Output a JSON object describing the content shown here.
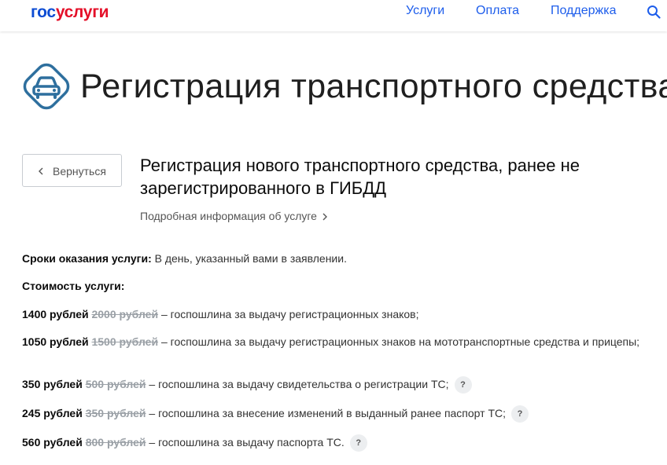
{
  "header": {
    "logo_part1": "гос",
    "logo_part2": "услуги",
    "nav": [
      "Услуги",
      "Оплата",
      "Поддержка"
    ],
    "search_icon": "search-icon"
  },
  "page": {
    "icon": "car-icon",
    "title": "Регистрация транспортного средства"
  },
  "back_button": {
    "label": "Вернуться",
    "icon": "chevron-left-icon"
  },
  "service": {
    "title": "Регистрация нового транспортного средства, ранее не зарегистрированного в ГИБДД",
    "more_info": "Подробная информация об услуге"
  },
  "terms": {
    "label": "Сроки оказания услуги:",
    "value": " В день, указанный вами в заявлении."
  },
  "cost_heading": "Стоимость услуги:",
  "fees": [
    {
      "price": "1400 рублей",
      "old_price": "2000 рублей",
      "description": " – госпошлина за выдачу регистрационных знаков;",
      "help": false
    },
    {
      "price": "1050 рублей",
      "old_price": "1500 рублей",
      "description": " – госпошлина за выдачу регистрационных знаков на мототранспортные средства и прицепы;",
      "help": false
    },
    {
      "price": "350 рублей",
      "old_price": "500 рублей",
      "description": " – госпошлина за выдачу свидетельства о регистрации ТС;",
      "help": true
    },
    {
      "price": "245 рублей",
      "old_price": "350 рублей",
      "description": " – госпошлина за внесение изменений в выданный ранее паспорт ТС;",
      "help": true
    },
    {
      "price": "560 рублей",
      "old_price": "800 рублей",
      "description": " – госпошлина за выдачу паспорта ТС.",
      "help": true
    }
  ],
  "help_glyph": "?",
  "colors": {
    "brand_blue": "#0d4cd3",
    "brand_red": "#e40f28",
    "link": "#1d5deb",
    "icon": "#2e6f9e"
  }
}
